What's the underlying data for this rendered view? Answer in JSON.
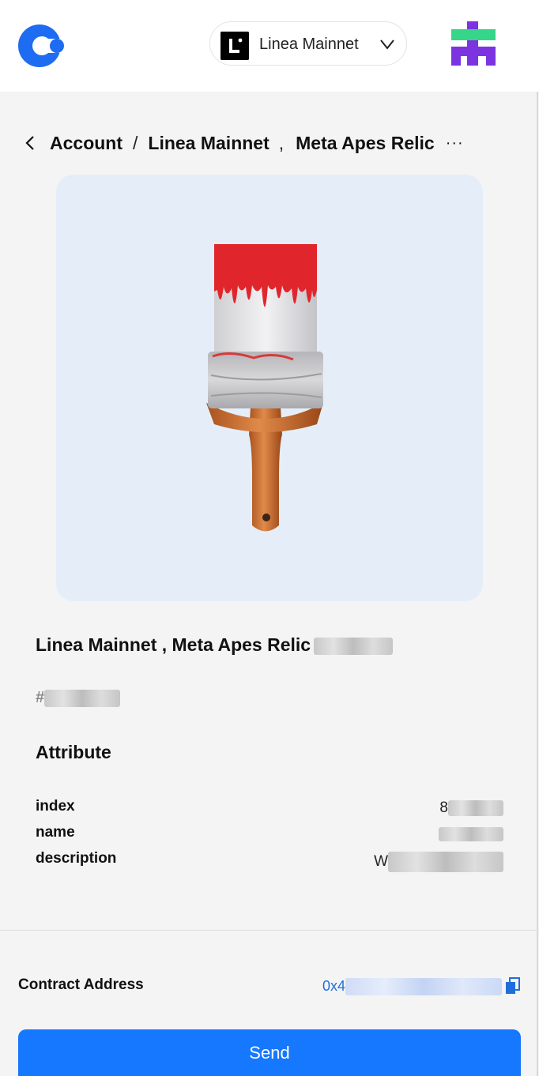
{
  "header": {
    "network": {
      "label": "Linea Mainnet",
      "icon": "linea-icon"
    },
    "logo_icon": "app-logo-icon",
    "avatar_icon": "account-avatar"
  },
  "breadcrumb": {
    "items": [
      "Account",
      "Linea Mainnet",
      "Meta Apes Relic"
    ],
    "separator": "/",
    "comma": ",",
    "more": "···"
  },
  "nft": {
    "title": "Linea Mainnet , Meta Apes Relic",
    "token_id_prefix": "#",
    "attributes_heading": "Attribute",
    "attributes": [
      {
        "key": "index",
        "value_visible": "8"
      },
      {
        "key": "name",
        "value_visible": ""
      },
      {
        "key": "description",
        "value_visible": "W"
      }
    ]
  },
  "contract": {
    "label": "Contract Address",
    "value_visible": "0x4"
  },
  "send_label": "Send",
  "colors": {
    "accent": "#1677ff",
    "link": "#1f6fdb",
    "card_bg": "#e5eef8",
    "page_bg": "#f4f4f4"
  }
}
